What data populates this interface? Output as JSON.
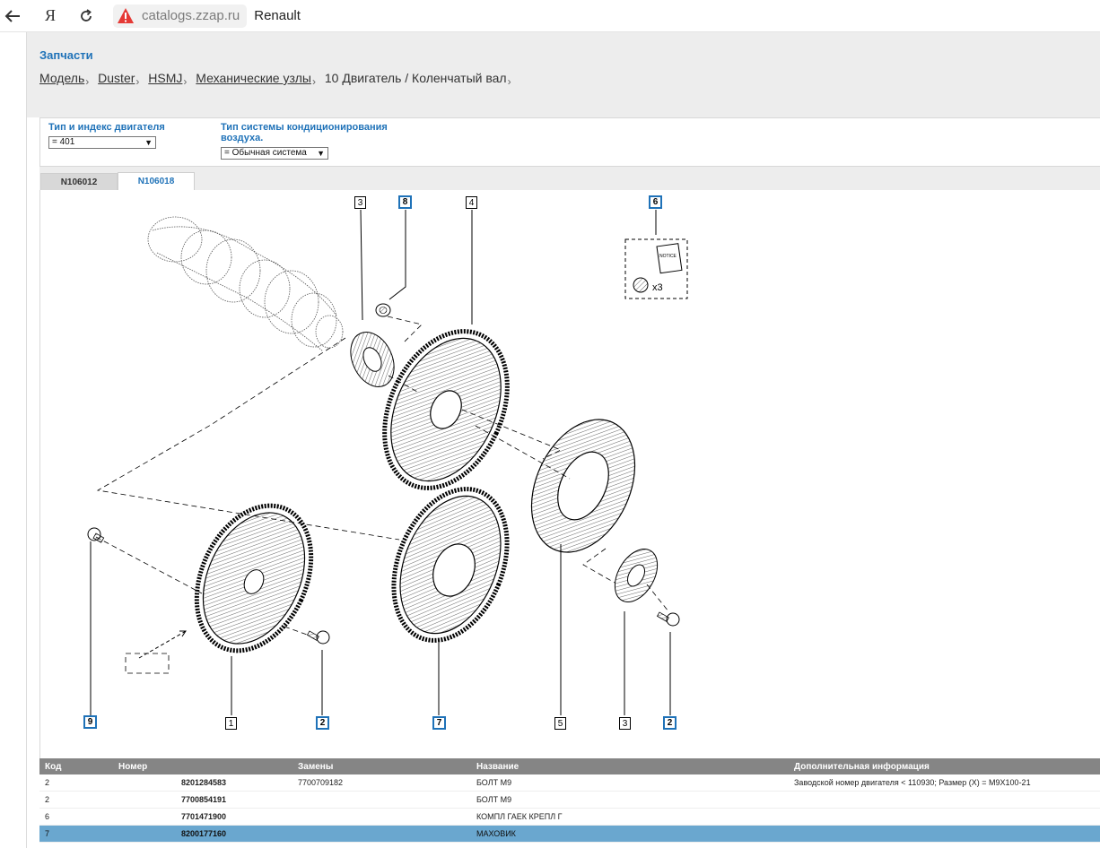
{
  "browser": {
    "back_icon": "back-arrow-icon",
    "ya_label": "Я",
    "reload_icon": "reload-icon",
    "domain": "catalogs.zzap.ru",
    "title": "Renault"
  },
  "header": {
    "section_title": "Запчасти",
    "breadcrumb": [
      {
        "label": "Модель",
        "link": true
      },
      {
        "label": "Duster",
        "link": true
      },
      {
        "label": "HSMJ",
        "link": true
      },
      {
        "label": "Механические узлы",
        "link": true
      },
      {
        "label": "10 Двигатель / Коленчатый вал",
        "link": false
      }
    ]
  },
  "filters": {
    "engine": {
      "label": "Тип и индекс двигателя",
      "value": "= 401"
    },
    "aircon": {
      "label_line1": "Тип системы кондиционирования",
      "label_line2": "воздуха.",
      "value": "= Обычная система"
    }
  },
  "tabs": [
    {
      "label": "N106012",
      "active": false
    },
    {
      "label": "N106018",
      "active": true
    }
  ],
  "diagram": {
    "callouts": [
      {
        "id": "c3a",
        "text": "3",
        "link": false
      },
      {
        "id": "c8",
        "text": "8",
        "link": true
      },
      {
        "id": "c4",
        "text": "4",
        "link": false
      },
      {
        "id": "c6",
        "text": "6",
        "link": true
      },
      {
        "id": "c9",
        "text": "9",
        "link": true
      },
      {
        "id": "c1",
        "text": "1",
        "link": false
      },
      {
        "id": "c2a",
        "text": "2",
        "link": true
      },
      {
        "id": "c7",
        "text": "7",
        "link": true
      },
      {
        "id": "c5",
        "text": "5",
        "link": false
      },
      {
        "id": "c3b",
        "text": "3",
        "link": false
      },
      {
        "id": "c2b",
        "text": "2",
        "link": true
      }
    ],
    "notice_text": "NOTICE",
    "qty_text": "x3"
  },
  "table": {
    "headers": {
      "code": "Код",
      "number": "Номер",
      "replacement": "Замены",
      "name": "Название",
      "info": "Дополнительная информация"
    },
    "rows": [
      {
        "code": "2",
        "number": "8201284583",
        "replacement": "7700709182",
        "name": "БОЛТ М9",
        "info": "Заводской номер двигателя < 110930; Размер (X) = M9X100-21",
        "selected": false
      },
      {
        "code": "2",
        "number": "7700854191",
        "replacement": "",
        "name": "БОЛТ М9",
        "info": "",
        "selected": false
      },
      {
        "code": "6",
        "number": "7701471900",
        "replacement": "",
        "name": "КОМПЛ ГАЕК КРЕПЛ Г",
        "info": "",
        "selected": false
      },
      {
        "code": "7",
        "number": "8200177160",
        "replacement": "",
        "name": "МАХОВИК",
        "info": "",
        "selected": true
      }
    ]
  },
  "colors": {
    "accent": "#1f72b8",
    "selected_row": "#6aa7cf",
    "table_header": "#858585",
    "warning": "#e53935"
  }
}
